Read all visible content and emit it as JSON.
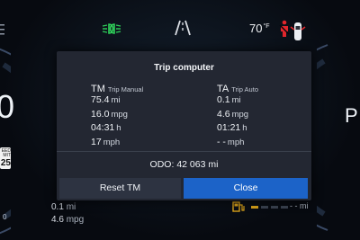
{
  "status_bar": {
    "temperature": "70",
    "temperature_unit": "°F",
    "icons": [
      "low-beam-indicator-icon",
      "lane-assist-icon",
      "seatbelt-warning-icon",
      "car-door-open-icon"
    ],
    "colors": {
      "lamp": "#2fd05a",
      "warning": "#e0262c"
    }
  },
  "background": {
    "speed_digit": "0",
    "gear": "P",
    "speed_limit_label": "EED\nMIT",
    "speed_limit_value": "25",
    "gauge_zero": "0",
    "trip_distance": "0.1",
    "trip_distance_unit": "mi",
    "trip_consumption": "4.6",
    "trip_consumption_unit": "mpg",
    "range": "- - mi",
    "fuel_level_fraction": 0.15
  },
  "dialog": {
    "title": "Trip computer",
    "manual": {
      "abbr": "TM",
      "label": "Trip Manual",
      "distance": "75.4",
      "distance_unit": "mi",
      "consumption": "16.0",
      "consumption_unit": "mpg",
      "time": "04:31",
      "time_unit": "h",
      "speed": "17",
      "speed_unit": "mph"
    },
    "auto": {
      "abbr": "TA",
      "label": "Trip Auto",
      "distance": "0.1",
      "distance_unit": "mi",
      "consumption": "4.6",
      "consumption_unit": "mpg",
      "time": "01:21",
      "time_unit": "h",
      "speed": "- -",
      "speed_unit": "mph"
    },
    "odo_label": "ODO:",
    "odo_value": "42 063",
    "odo_unit": "mi",
    "reset_label": "Reset TM",
    "close_label": "Close",
    "colors": {
      "close_button": "#1c63c8",
      "reset_button": "#2d3341"
    }
  }
}
